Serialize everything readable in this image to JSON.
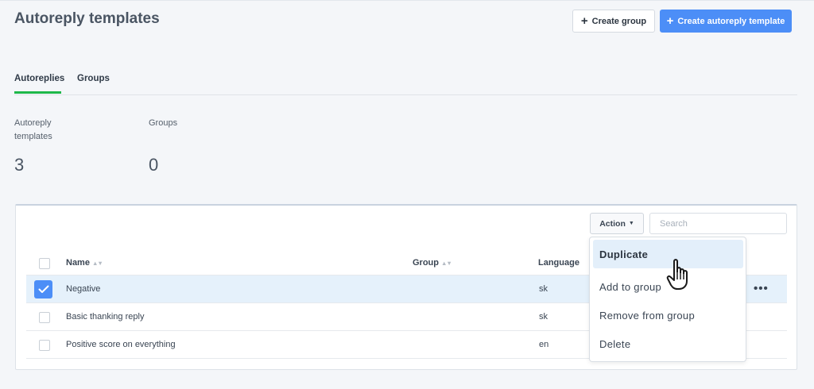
{
  "page": {
    "title": "Autoreply templates"
  },
  "header_buttons": {
    "create_group": "Create group",
    "create_template": "Create autoreply template",
    "plus_icon": "+"
  },
  "tabs": [
    {
      "label": "Autoreplies",
      "active": true
    },
    {
      "label": "Groups",
      "active": false
    }
  ],
  "stats": [
    {
      "label": "Autoreply templates",
      "value": "3"
    },
    {
      "label": "Groups",
      "value": "0"
    }
  ],
  "toolbar": {
    "action_label": "Action",
    "caret_icon": "caret-down-icon",
    "search_placeholder": "Search"
  },
  "table": {
    "columns": [
      "Name",
      "Group",
      "Language"
    ],
    "rows": [
      {
        "name": "Negative",
        "group": "",
        "language": "sk",
        "selected": true
      },
      {
        "name": "Basic thanking reply",
        "group": "",
        "language": "sk",
        "selected": false
      },
      {
        "name": "Positive score on everything",
        "group": "",
        "language": "en",
        "selected": false
      }
    ],
    "more_icon": "•••"
  },
  "action_menu": {
    "items": [
      "Duplicate",
      "Add to group",
      "Remove from group",
      "Delete"
    ],
    "highlighted": "Duplicate"
  },
  "colors": {
    "accent_blue": "#4c8ef7",
    "tab_green": "#1fb84a",
    "selected_row": "#e5f1fb"
  }
}
